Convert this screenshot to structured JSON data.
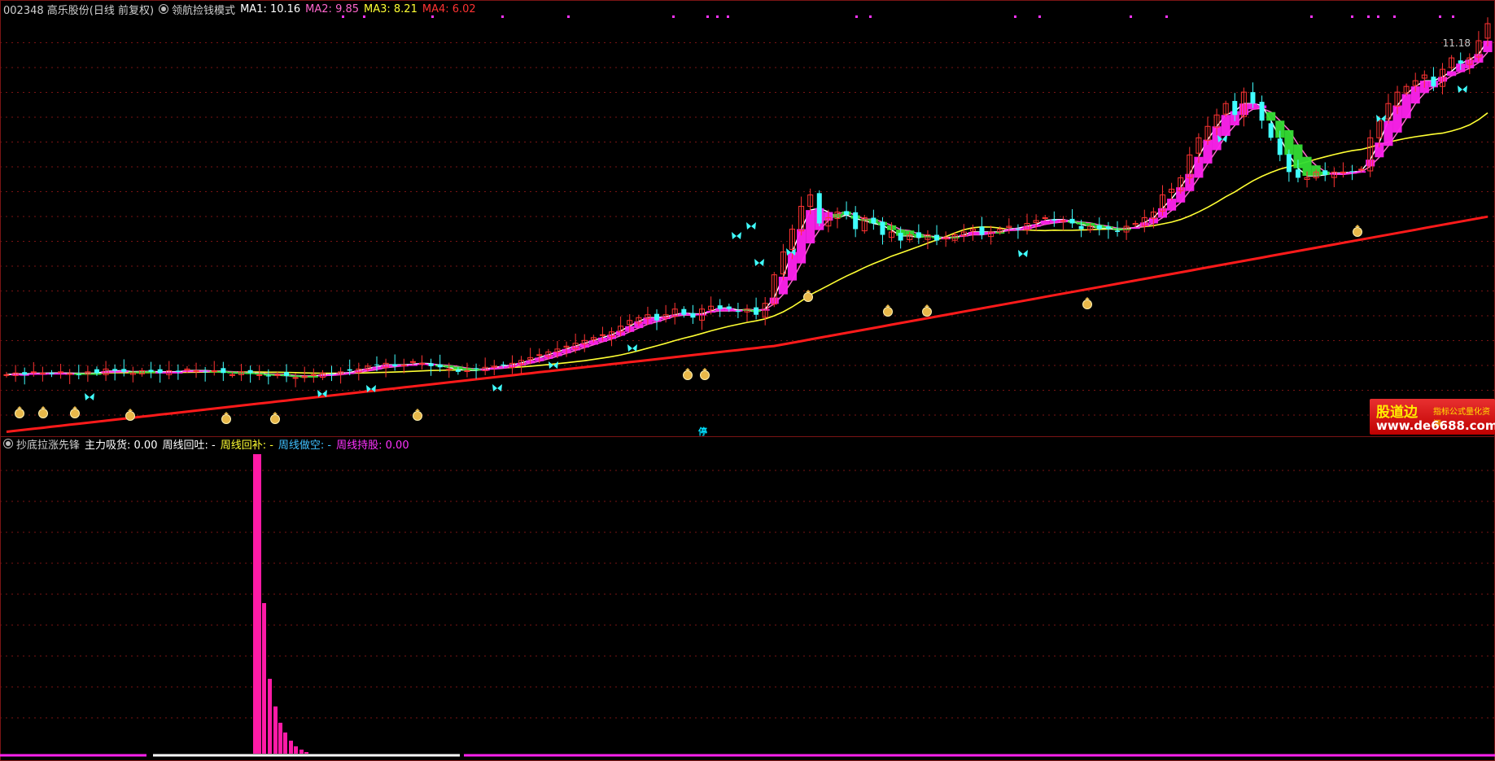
{
  "price_panel": {
    "stock": "002348 高乐股份(日线 前复权)",
    "formula": "领航捡钱模式",
    "ma": [
      {
        "label": "MA1: 10.16",
        "color": "#ffffff"
      },
      {
        "label": "MA2: 9.85",
        "color": "#ff66cc"
      },
      {
        "label": "MA3: 8.21",
        "color": "#ffff33"
      },
      {
        "label": "MA4: 6.02",
        "color": "#ff3333"
      }
    ],
    "high_label": "11.18",
    "stop_mark": "停"
  },
  "indicator_panel": {
    "name": "抄底拉涨先锋",
    "items": [
      {
        "label": "主力吸货: 0.00",
        "color": "#ffffff"
      },
      {
        "label": "周线回吐: -",
        "color": "#ffffff"
      },
      {
        "label": "周线回补: -",
        "color": "#ffff33"
      },
      {
        "label": "周线做空: -",
        "color": "#40c0ff"
      },
      {
        "label": "周线持股: 0.00",
        "color": "#ff33ff"
      }
    ]
  },
  "logo": {
    "name": "股道边",
    "slogan": "指标公式量化资源",
    "url": "www.de6688.com"
  },
  "colors": {
    "up": "#ff3333",
    "down": "#40ffff",
    "ma1": "#ffffff",
    "ma2": "#ff66cc",
    "ma3": "#ffff33",
    "ma4": "#ff1a1a",
    "band": "#ff22ee",
    "band_alt": "#33dd33",
    "grid": "#7a1414",
    "hist": "#ff1aa6"
  },
  "icons": {
    "buy_signal": "money-bag-icon",
    "sell_signal": "butterfly-icon"
  },
  "series": {
    "closes": [
      7.05,
      7.08,
      7.05,
      7.1,
      7.08,
      7.06,
      7.1,
      7.07,
      7.05,
      7.1,
      7.08,
      7.15,
      7.12,
      7.1,
      7.08,
      7.12,
      7.1,
      7.08,
      7.12,
      7.1,
      7.15,
      7.12,
      7.1,
      7.12,
      7.08,
      7.05,
      7.1,
      7.08,
      7.05,
      7.02,
      7.05,
      7.03,
      7.0,
      7.02,
      7.05,
      7.08,
      7.05,
      7.1,
      7.12,
      7.15,
      7.2,
      7.22,
      7.25,
      7.2,
      7.22,
      7.28,
      7.25,
      7.2,
      7.18,
      7.15,
      7.1,
      7.12,
      7.15,
      7.18,
      7.2,
      7.22,
      7.25,
      7.3,
      7.35,
      7.4,
      7.45,
      7.5,
      7.55,
      7.6,
      7.65,
      7.7,
      7.75,
      7.8,
      7.9,
      8.0,
      8.05,
      8.1,
      8.0,
      8.1,
      8.2,
      8.1,
      8.05,
      8.2,
      8.25,
      8.2,
      8.2,
      8.15,
      8.2,
      8.1,
      8.3,
      8.8,
      9.2,
      9.6,
      10.0,
      10.2,
      9.7,
      9.8,
      9.9,
      9.85,
      9.6,
      9.8,
      9.7,
      9.5,
      9.55,
      9.4,
      9.5,
      9.45,
      9.5,
      9.4,
      9.45,
      9.5,
      9.55,
      9.6,
      9.5,
      9.55,
      9.6,
      9.65,
      9.6,
      9.7,
      9.75,
      9.8,
      9.75,
      9.75,
      9.7,
      9.6,
      9.65,
      9.6,
      9.6,
      9.55,
      9.65,
      9.7,
      9.8,
      9.9,
      10.2,
      10.3,
      10.5,
      10.9,
      11.2,
      11.4,
      11.6,
      11.8,
      11.6,
      12.0,
      11.8,
      11.5,
      11.2,
      10.9,
      10.6,
      10.5,
      10.5,
      10.6,
      10.55,
      10.6,
      10.6,
      10.6,
      10.65,
      11.2,
      11.5,
      11.8,
      12.0,
      12.1,
      12.2,
      12.3,
      12.1,
      12.4,
      12.6,
      12.5,
      12.6,
      12.9,
      13.2
    ]
  }
}
